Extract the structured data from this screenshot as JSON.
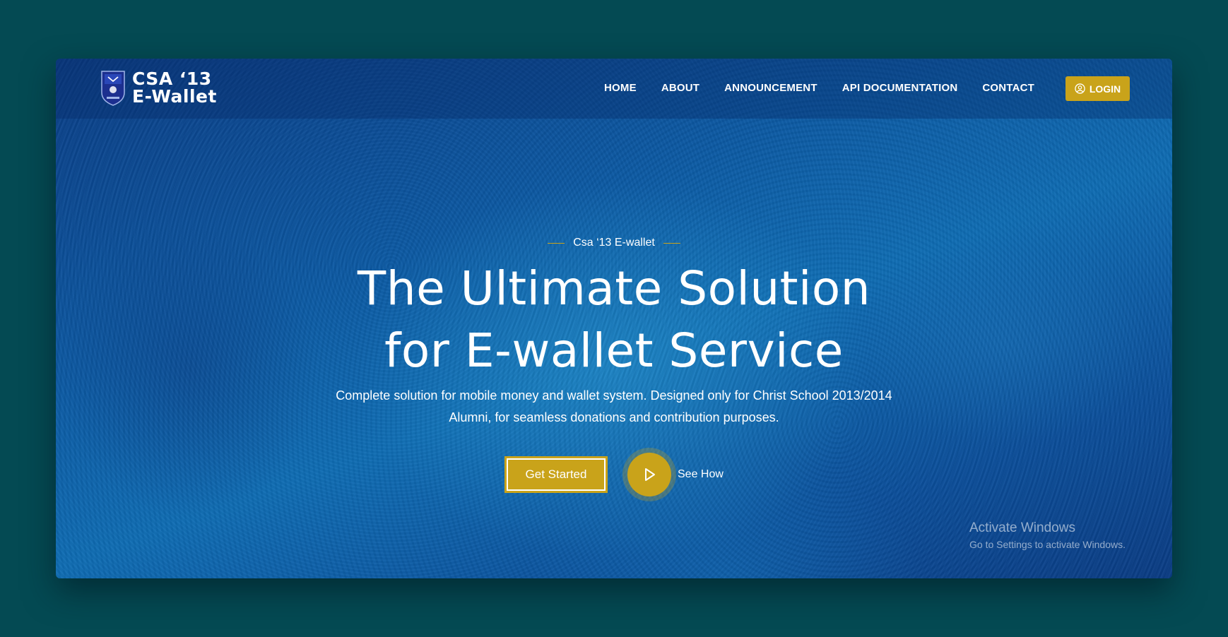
{
  "header": {
    "logo_line1": "CSA ‘13",
    "logo_line2": "E-Wallet",
    "nav": {
      "home": "HOME",
      "about": "ABOUT",
      "announcement": "ANNOUNCEMENT",
      "api_documentation": "API DOCUMENTATION",
      "contact": "CONTACT"
    },
    "login_label": "LOGIN"
  },
  "hero": {
    "eyebrow": "Csa ‘13 E-wallet",
    "headline_line1": "The Ultimate Solution",
    "headline_line2": "for E-wallet Service",
    "subtitle": "Complete solution for mobile money and wallet system. Designed only for Christ School 2013/2014 Alumni, for seamless donations and contribution purposes.",
    "cta_primary": "Get Started",
    "cta_secondary": "See How"
  },
  "os_watermark": {
    "title": "Activate Windows",
    "subtitle": "Go to Settings to activate Windows."
  },
  "colors": {
    "page_background": "#044a53",
    "accent_gold": "#c9a31a",
    "hero_blue": "#0c5aa4"
  },
  "icons": {
    "crest": "school-crest-icon",
    "login": "user-circle-icon",
    "play": "play-icon"
  }
}
